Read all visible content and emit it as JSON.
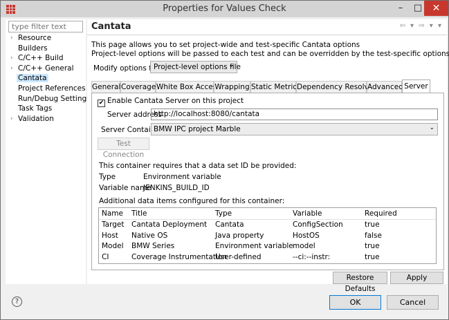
{
  "window": {
    "title": "Properties for Values Check",
    "minimize": "–",
    "maximize": "□",
    "close": "✕"
  },
  "left": {
    "filter_placeholder": "type filter text",
    "items": [
      {
        "label": "Resource",
        "arrow": "›"
      },
      {
        "label": "Builders",
        "arrow": ""
      },
      {
        "label": "C/C++ Build",
        "arrow": "›"
      },
      {
        "label": "C/C++ General",
        "arrow": "›"
      },
      {
        "label": "Cantata",
        "arrow": ""
      },
      {
        "label": "Project References",
        "arrow": ""
      },
      {
        "label": "Run/Debug Settings",
        "arrow": ""
      },
      {
        "label": "Task Tags",
        "arrow": ""
      },
      {
        "label": "Validation",
        "arrow": "›"
      }
    ]
  },
  "page": {
    "title": "Cantata",
    "nav_icons": "⇦ ▾ ⇨ ▾ ▾",
    "desc1": "This page allows you to set project-wide and test-specific Cantata options",
    "desc2": "Project-level options will be passed to each test and can be overridden by the test-specific options",
    "modify_label": "Modify options for",
    "modify_value": "Project-level options file"
  },
  "tabs": [
    "General",
    "Coverage",
    "White Box Access",
    "Wrapping",
    "Static Metrics",
    "Dependency Resolver",
    "Advanced",
    "Server"
  ],
  "server": {
    "enable_label": "Enable Cantata Server on this project",
    "enable_checked": "✔",
    "address_label": "Server address",
    "address_value": "http://localhost:8080/cantata",
    "container_label": "Server Container",
    "container_value": "BMW IPC project Marble",
    "test_button": "Test Connection",
    "requires_text": "This container requires that a data set ID be provided:",
    "type_label": "Type",
    "type_value": "Environment variable",
    "varname_label": "Variable name",
    "varname_value": "JENKINS_BUILD_ID",
    "additional_text": "Additional data items configured for this container:",
    "table": {
      "headers": [
        "Name",
        "Title",
        "Type",
        "Variable",
        "Required"
      ],
      "rows": [
        [
          "Target",
          "Cantata Deployment",
          "Cantata",
          "ConfigSection",
          "true"
        ],
        [
          "Host",
          "Native OS",
          "Java property",
          "HostOS",
          "false"
        ],
        [
          "Model",
          "BMW Series",
          "Environment variable",
          "model",
          "true"
        ],
        [
          "CI",
          "Coverage Instrumentation",
          "User-defined",
          "--ci:--instr:",
          "true"
        ]
      ]
    }
  },
  "buttons": {
    "restore": "Restore Defaults",
    "apply": "Apply",
    "ok": "OK",
    "cancel": "Cancel",
    "help": "?"
  },
  "colors": {
    "accent": "#0078d7",
    "close": "#c8372d",
    "selection": "#cce8ff"
  }
}
